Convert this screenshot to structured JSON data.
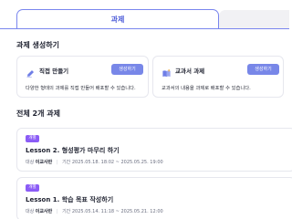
{
  "tabs": {
    "active_label": "과제"
  },
  "create_section": {
    "title": "과제 생성하기",
    "cards": [
      {
        "icon": "pencil-icon",
        "title": "직접 만들기",
        "button": "생성하기",
        "description": "다양한 형태의 과제를 직접 만들어 배포할 수 있습니다."
      },
      {
        "icon": "book-icon",
        "title": "교과서 과제",
        "button": "생성하기",
        "description": "교과서의 내용을 과제로 배포할 수 있습니다."
      }
    ]
  },
  "list_section": {
    "title": "전체 2개 과제"
  },
  "tasks": [
    {
      "badge": "개별",
      "title": "Lesson 2. 형성평가 마무리 하기",
      "target_label": "대상",
      "target_value": "이교사반",
      "period_label": "기간",
      "period": "2025.05.18. 18:02 ~ 2025.05.25. 19:00"
    },
    {
      "badge": "개별",
      "title": "Lesson 1. 학습 목표 작성하기",
      "target_label": "대상",
      "target_value": "이교사반",
      "period_label": "기간",
      "period": "2025.05.14. 11:18 ~ 2025.05.21. 12:00"
    }
  ],
  "colors": {
    "accent": "#4c5bd8",
    "button": "#7887e8",
    "badge": "#8b5cf6",
    "border": "#e6e7ee"
  }
}
